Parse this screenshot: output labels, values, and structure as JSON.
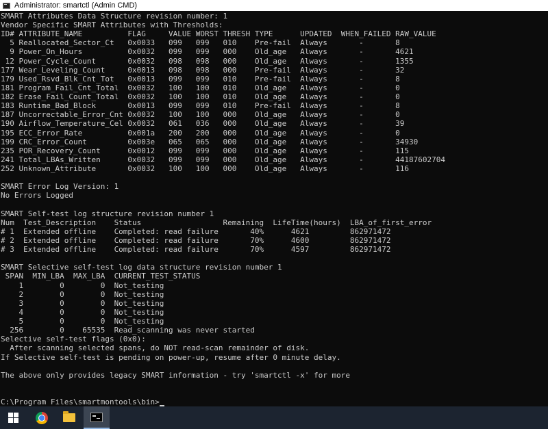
{
  "window": {
    "title": "Administrator: smartctl (Admin CMD)"
  },
  "console": {
    "lines": [
      "SMART Attributes Data Structure revision number: 1",
      "Vendor Specific SMART Attributes with Thresholds:",
      "ID# ATTRIBUTE_NAME          FLAG     VALUE WORST THRESH TYPE      UPDATED  WHEN_FAILED RAW_VALUE",
      "  5 Reallocated_Sector_Ct   0x0033   099   099   010    Pre-fail  Always       -       8",
      "  9 Power_On_Hours          0x0032   099   099   000    Old_age   Always       -       4621",
      " 12 Power_Cycle_Count       0x0032   098   098   000    Old_age   Always       -       1355",
      "177 Wear_Leveling_Count     0x0013   098   098   000    Pre-fail  Always       -       32",
      "179 Used_Rsvd_Blk_Cnt_Tot   0x0013   099   099   010    Pre-fail  Always       -       8",
      "181 Program_Fail_Cnt_Total  0x0032   100   100   010    Old_age   Always       -       0",
      "182 Erase_Fail_Count_Total  0x0032   100   100   010    Old_age   Always       -       0",
      "183 Runtime_Bad_Block       0x0013   099   099   010    Pre-fail  Always       -       8",
      "187 Uncorrectable_Error_Cnt 0x0032   100   100   000    Old_age   Always       -       0",
      "190 Airflow_Temperature_Cel 0x0032   061   036   000    Old_age   Always       -       39",
      "195 ECC_Error_Rate          0x001a   200   200   000    Old_age   Always       -       0",
      "199 CRC_Error_Count         0x003e   065   065   000    Old_age   Always       -       34930",
      "235 POR_Recovery_Count      0x0012   099   099   000    Old_age   Always       -       115",
      "241 Total_LBAs_Written      0x0032   099   099   000    Old_age   Always       -       44187602704",
      "252 Unknown_Attribute       0x0032   100   100   000    Old_age   Always       -       116",
      "",
      "SMART Error Log Version: 1",
      "No Errors Logged",
      "",
      "SMART Self-test log structure revision number 1",
      "Num  Test_Description    Status                  Remaining  LifeTime(hours)  LBA_of_first_error",
      "# 1  Extended offline    Completed: read failure       40%      4621         862971472",
      "# 2  Extended offline    Completed: read failure       70%      4600         862971472",
      "# 3  Extended offline    Completed: read failure       70%      4597         862971472",
      "",
      "SMART Selective self-test log data structure revision number 1",
      " SPAN  MIN_LBA  MAX_LBA  CURRENT_TEST_STATUS",
      "    1        0        0  Not_testing",
      "    2        0        0  Not_testing",
      "    3        0        0  Not_testing",
      "    4        0        0  Not_testing",
      "    5        0        0  Not_testing",
      "  256        0    65535  Read_scanning was never started",
      "Selective self-test flags (0x0):",
      "  After scanning selected spans, do NOT read-scan remainder of disk.",
      "If Selective self-test is pending on power-up, resume after 0 minute delay.",
      "",
      "The above only provides legacy SMART information - try 'smartctl -x' for more",
      "",
      "",
      "C:\\Program Files\\smartmontools\\bin>"
    ]
  },
  "taskbar": {
    "items": [
      {
        "icon": "windows-start-icon"
      },
      {
        "icon": "chrome-icon"
      },
      {
        "icon": "file-explorer-icon"
      },
      {
        "icon": "command-prompt-icon",
        "active": true
      }
    ]
  },
  "colors": {
    "console_bg": "#0c0c0c",
    "console_fg": "#cccccc",
    "taskbar_bg": "#1c2430"
  }
}
